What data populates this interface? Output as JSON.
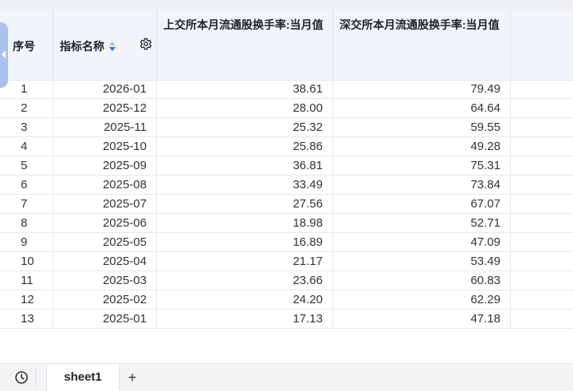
{
  "header": {
    "col_index": "序号",
    "col_name": "指标名称",
    "col_sh": "上交所本月流通股换手率:当月值",
    "col_sz": "深交所本月流通股换手率:当月值"
  },
  "rows": [
    {
      "idx": "1",
      "date": "2026-01",
      "sh": "38.61",
      "sz": "79.49"
    },
    {
      "idx": "2",
      "date": "2025-12",
      "sh": "28.00",
      "sz": "64.64"
    },
    {
      "idx": "3",
      "date": "2025-11",
      "sh": "25.32",
      "sz": "59.55"
    },
    {
      "idx": "4",
      "date": "2025-10",
      "sh": "25.86",
      "sz": "49.28"
    },
    {
      "idx": "5",
      "date": "2025-09",
      "sh": "36.81",
      "sz": "75.31"
    },
    {
      "idx": "6",
      "date": "2025-08",
      "sh": "33.49",
      "sz": "73.84"
    },
    {
      "idx": "7",
      "date": "2025-07",
      "sh": "27.56",
      "sz": "67.07"
    },
    {
      "idx": "8",
      "date": "2025-06",
      "sh": "18.98",
      "sz": "52.71"
    },
    {
      "idx": "9",
      "date": "2025-05",
      "sh": "16.89",
      "sz": "47.09"
    },
    {
      "idx": "10",
      "date": "2025-04",
      "sh": "21.17",
      "sz": "53.49"
    },
    {
      "idx": "11",
      "date": "2025-03",
      "sh": "23.66",
      "sz": "60.83"
    },
    {
      "idx": "12",
      "date": "2025-02",
      "sh": "24.20",
      "sz": "62.29"
    },
    {
      "idx": "13",
      "date": "2025-01",
      "sh": "17.13",
      "sz": "47.18"
    }
  ],
  "tabs": {
    "sheet_label": "sheet1",
    "add_label": "+"
  },
  "icons": {
    "history": "clock-icon",
    "settings": "gear-icon",
    "sort": "sort-icon",
    "collapse": "chevron-left-icon"
  },
  "colors": {
    "header_bg": "#f1f4fa",
    "sort_active": "#2b6ff2",
    "edge_tab": "#a9c3ee"
  }
}
